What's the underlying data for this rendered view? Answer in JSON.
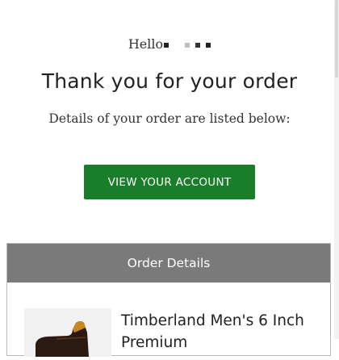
{
  "greeting": {
    "text": "Hello"
  },
  "title": "Thank you for your order",
  "subtitle": "Details of your order are listed below:",
  "account_button": {
    "label": "VIEW YOUR ACCOUNT",
    "color": "#1a7d2a"
  },
  "order_details": {
    "header": "Order Details",
    "header_color": "#7a7a7a",
    "items": [
      {
        "title": "Timberland Men's 6 Inch Premium",
        "image_icon": "boot-image"
      }
    ]
  }
}
